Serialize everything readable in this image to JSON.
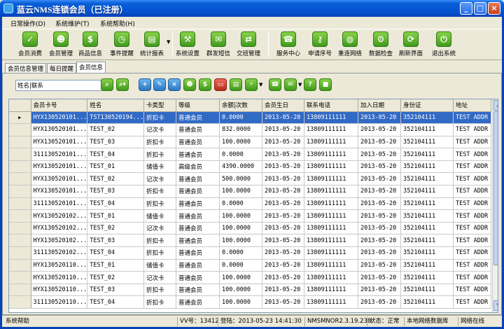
{
  "window": {
    "title": "蓝云NMS连锁会员（已注册）"
  },
  "menu": [
    {
      "label": "日常操作(D)"
    },
    {
      "label": "系统维护(T)"
    },
    {
      "label": "系统帮助(H)"
    }
  ],
  "toolbar": [
    {
      "label": "会员消费",
      "icon": "cart-icon"
    },
    {
      "label": "会员管理",
      "icon": "member-icon"
    },
    {
      "label": "商品信息",
      "icon": "dollar-icon"
    },
    {
      "label": "事件提醒",
      "icon": "clock-icon"
    },
    {
      "label": "统计报表",
      "icon": "chart-icon"
    },
    {
      "label": "系统设置",
      "icon": "wrench-icon"
    },
    {
      "label": "群发短信",
      "icon": "mail-icon"
    },
    {
      "label": "交班管理",
      "icon": "exchange-icon"
    },
    {
      "label": "服务中心",
      "icon": "chat-icon"
    },
    {
      "label": "申请序号",
      "icon": "key-icon"
    },
    {
      "label": "重连网络",
      "icon": "globe-icon"
    },
    {
      "label": "数据检查",
      "icon": "check-icon"
    },
    {
      "label": "刷新界面",
      "icon": "refresh-icon"
    },
    {
      "label": "退出系统",
      "icon": "power-icon"
    }
  ],
  "tabs": [
    {
      "label": "会员信息管理"
    },
    {
      "label": "每日提醒"
    },
    {
      "label": "会员信息"
    }
  ],
  "search": {
    "value": "姓名|联系"
  },
  "table": {
    "columns": [
      "会员卡号",
      "姓名",
      "卡类型",
      "等级",
      "余额|次数",
      "会员生日",
      "联系电话",
      "加入日期",
      "身份证",
      "地址"
    ],
    "rows": [
      [
        "HYX130520101...",
        "TST130520194...",
        "折扣卡",
        "普通会员",
        "0.0000",
        "2013-05-20",
        "13809111111",
        "2013-05-20",
        "352104111",
        "TEST ADDR"
      ],
      [
        "HYX130520101...",
        "TEST_02",
        "记次卡",
        "普通会员",
        "832.0000",
        "2013-05-20",
        "13809111111",
        "2013-05-20",
        "352104111",
        "TEST ADDR"
      ],
      [
        "HYX130520101...",
        "TEST_03",
        "折扣卡",
        "普通会员",
        "100.0000",
        "2013-05-20",
        "13809111111",
        "2013-05-20",
        "352104111",
        "TEST ADDR"
      ],
      [
        "311130520101...",
        "TEST_04",
        "折扣卡",
        "普通会员",
        "0.0000",
        "2013-05-20",
        "13809111111",
        "2013-05-20",
        "352104111",
        "TEST ADDR"
      ],
      [
        "HYX130520101...",
        "TEST_01",
        "储值卡",
        "高级会员",
        "4390.0000",
        "2013-05-20",
        "13809111111",
        "2013-05-20",
        "352104111",
        "TEST ADDR"
      ],
      [
        "HYX130520101...",
        "TEST_02",
        "记次卡",
        "普通会员",
        "500.0000",
        "2013-05-20",
        "13809111111",
        "2013-05-20",
        "352104111",
        "TEST ADDR"
      ],
      [
        "HYX130520101...",
        "TEST_03",
        "折扣卡",
        "普通会员",
        "100.0000",
        "2013-05-20",
        "13809111111",
        "2013-05-20",
        "352104111",
        "TEST ADDR"
      ],
      [
        "311130520101...",
        "TEST_04",
        "折扣卡",
        "普通会员",
        "0.0000",
        "2013-05-20",
        "13809111111",
        "2013-05-20",
        "352104111",
        "TEST ADDR"
      ],
      [
        "HYX130520102...",
        "TEST_01",
        "储值卡",
        "普通会员",
        "100.0000",
        "2013-05-20",
        "13809111111",
        "2013-05-20",
        "352104111",
        "TEST ADDR"
      ],
      [
        "HYX130520102...",
        "TEST_02",
        "记次卡",
        "普通会员",
        "100.0000",
        "2013-05-20",
        "13809111111",
        "2013-05-20",
        "352104111",
        "TEST ADDR"
      ],
      [
        "HYX130520102...",
        "TEST_03",
        "折扣卡",
        "普通会员",
        "100.0000",
        "2013-05-20",
        "13809111111",
        "2013-05-20",
        "352104111",
        "TEST ADDR"
      ],
      [
        "311130520102...",
        "TEST_04",
        "折扣卡",
        "普通会员",
        "0.0000",
        "2013-05-20",
        "13809111111",
        "2013-05-20",
        "352104111",
        "TEST ADDR"
      ],
      [
        "HYX130520110...",
        "TEST_01",
        "储值卡",
        "普通会员",
        "0.0000",
        "2013-05-20",
        "13809111111",
        "2013-05-20",
        "352104111",
        "TEST ADDR"
      ],
      [
        "HYX130520110...",
        "TEST_02",
        "记次卡",
        "普通会员",
        "100.0000",
        "2013-05-20",
        "13809111111",
        "2013-05-20",
        "352104111",
        "TEST ADDR"
      ],
      [
        "HYX130520110...",
        "TEST_03",
        "折扣卡",
        "普通会员",
        "100.0000",
        "2013-05-20",
        "13809111111",
        "2013-05-20",
        "352104111",
        "TEST ADDR"
      ],
      [
        "311130520110...",
        "TEST_04",
        "折扣卡",
        "普通会员",
        "100.0000",
        "2013-05-20",
        "13809111111",
        "2013-05-20",
        "352104111",
        "TEST ADDR"
      ]
    ]
  },
  "status": {
    "help": "系统帮助",
    "vv": "VV号：13412",
    "login": "登陆：2013-05-23 14:41:30",
    "version": "NMSMNOR2.3.19.238",
    "state": "状态：正常",
    "db": "本地网络数据库",
    "network": "网络在线"
  },
  "colors": {
    "titlebar": "#0553d1",
    "selection": "#316ac5",
    "accent_green": "#3f9a1c"
  }
}
